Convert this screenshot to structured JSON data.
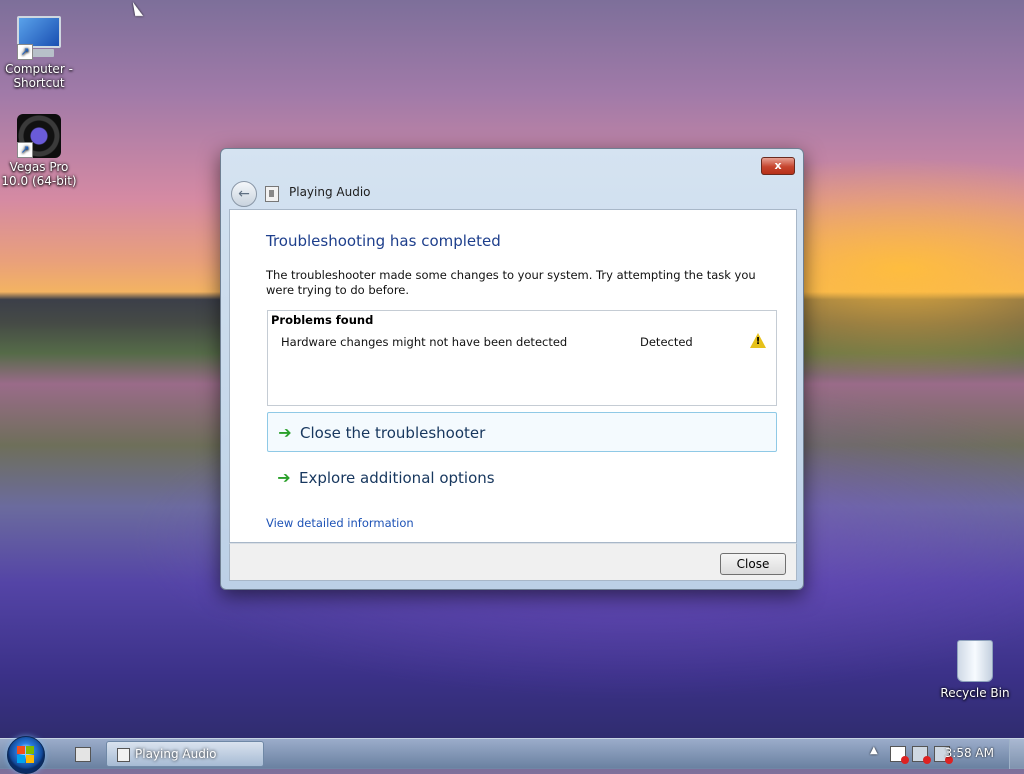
{
  "desktop": {
    "icons": [
      {
        "label": "Computer - Shortcut"
      },
      {
        "label": "Vegas Pro 10.0 (64-bit)"
      },
      {
        "label": "Recycle Bin"
      }
    ]
  },
  "dialog": {
    "nav_title": "Playing Audio",
    "heading": "Troubleshooting has completed",
    "description": "The troubleshooter made some changes to your system. Try attempting the task you were trying to do before.",
    "problems": {
      "title": "Problems found",
      "rows": [
        {
          "text": "Hardware changes might not have been detected",
          "status": "Detected",
          "icon": "warning-icon"
        }
      ]
    },
    "links": [
      {
        "label": "Close the troubleshooter",
        "icon": "green-arrow-icon"
      },
      {
        "label": "Explore additional options",
        "icon": "green-arrow-icon"
      }
    ],
    "detail_link": "View detailed information",
    "close_button": "Close",
    "title_close_glyph": "x"
  },
  "taskbar": {
    "active_window": "Playing Audio",
    "clock": "3:58 AM",
    "tray_glyph": "▲"
  },
  "colors": {
    "heading": "#1e3f8c",
    "link": "#1e53b6",
    "arrow": "#2aa02a",
    "warning": "#e6c11a"
  }
}
